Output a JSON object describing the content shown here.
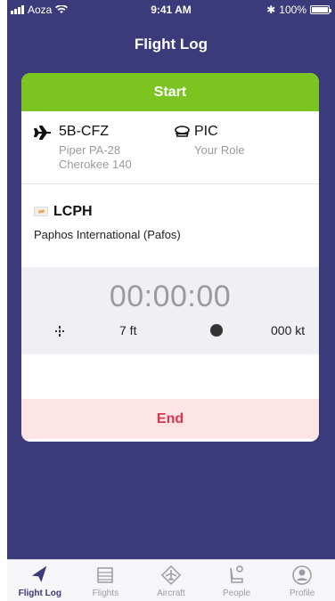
{
  "status_bar": {
    "carrier": "Aoza",
    "time": "9:41 AM",
    "battery": "100%"
  },
  "nav": {
    "title": "Flight Log"
  },
  "card": {
    "start_label": "Start",
    "aircraft": {
      "registration": "5B-CFZ",
      "model": "Piper PA-28 Cherokee 140"
    },
    "role": {
      "value": "PIC",
      "label": "Your Role"
    },
    "airport": {
      "code": "LCPH",
      "name": "Paphos International (Pafos)"
    },
    "timer": "00:00:00",
    "altitude": "7 ft",
    "speed": "000 kt",
    "end_label": "End"
  },
  "tabs": [
    {
      "label": "Flight Log",
      "icon": "plane-icon",
      "active": true
    },
    {
      "label": "Flights",
      "icon": "list-icon",
      "active": false
    },
    {
      "label": "Aircraft",
      "icon": "aircraft-icon",
      "active": false
    },
    {
      "label": "People",
      "icon": "people-icon",
      "active": false
    },
    {
      "label": "Profile",
      "icon": "profile-icon",
      "active": false
    }
  ],
  "colors": {
    "background": "#3b3a7a",
    "start": "#7cc520",
    "end_bg": "#fde5e5",
    "end_text": "#e0334a"
  }
}
